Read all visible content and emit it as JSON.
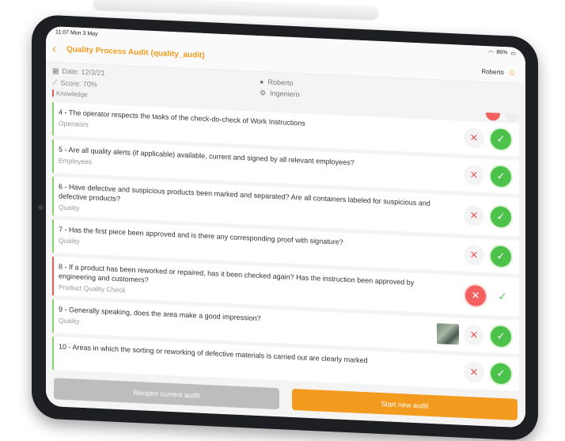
{
  "status_bar": {
    "time": "11:07",
    "date": "Mon 3 May",
    "battery": "86%"
  },
  "header": {
    "title": "Quality Process Audit (quality_audit)",
    "user": "Roberto"
  },
  "info": {
    "date": "Date: 12/3/21",
    "score": "Score: 70%",
    "person": "Roberto",
    "role": "Ingeniero",
    "prev_category": "Knowledge"
  },
  "items": [
    {
      "question": "4 - The operator respects the tasks of the check-do-check of Work Instructions",
      "category": "Operators"
    },
    {
      "question": "5 - Are all quality alerts (if applicable) available, current and signed by all relevant employees?",
      "category": "Employees"
    },
    {
      "question": "6 - Have defective and suspicious products been marked and separated? Are all containers labeled for suspicious and defective products?",
      "category": "Quality"
    },
    {
      "question": "7 - Has the first piece been approved and is there any corresponding proof with signature?",
      "category": "Quality"
    },
    {
      "question": "8 - If a product has been reworked or repaired, has it been checked again? Has the instruction been approved by engineering and customers?",
      "category": "Product Quality Check"
    },
    {
      "question": "9 - Generally speaking, does the area make a good impression?",
      "category": "Quality"
    },
    {
      "question": "10 - Areas in which the sorting or reworking of defective materials is carried out are clearly marked",
      "category": ""
    }
  ],
  "buttons": {
    "reopen": "Reopen current audit",
    "start": "Start new audit"
  },
  "colors": {
    "accent": "#f29b1f",
    "ok": "#4cc24a",
    "fail": "#e35b5b"
  }
}
